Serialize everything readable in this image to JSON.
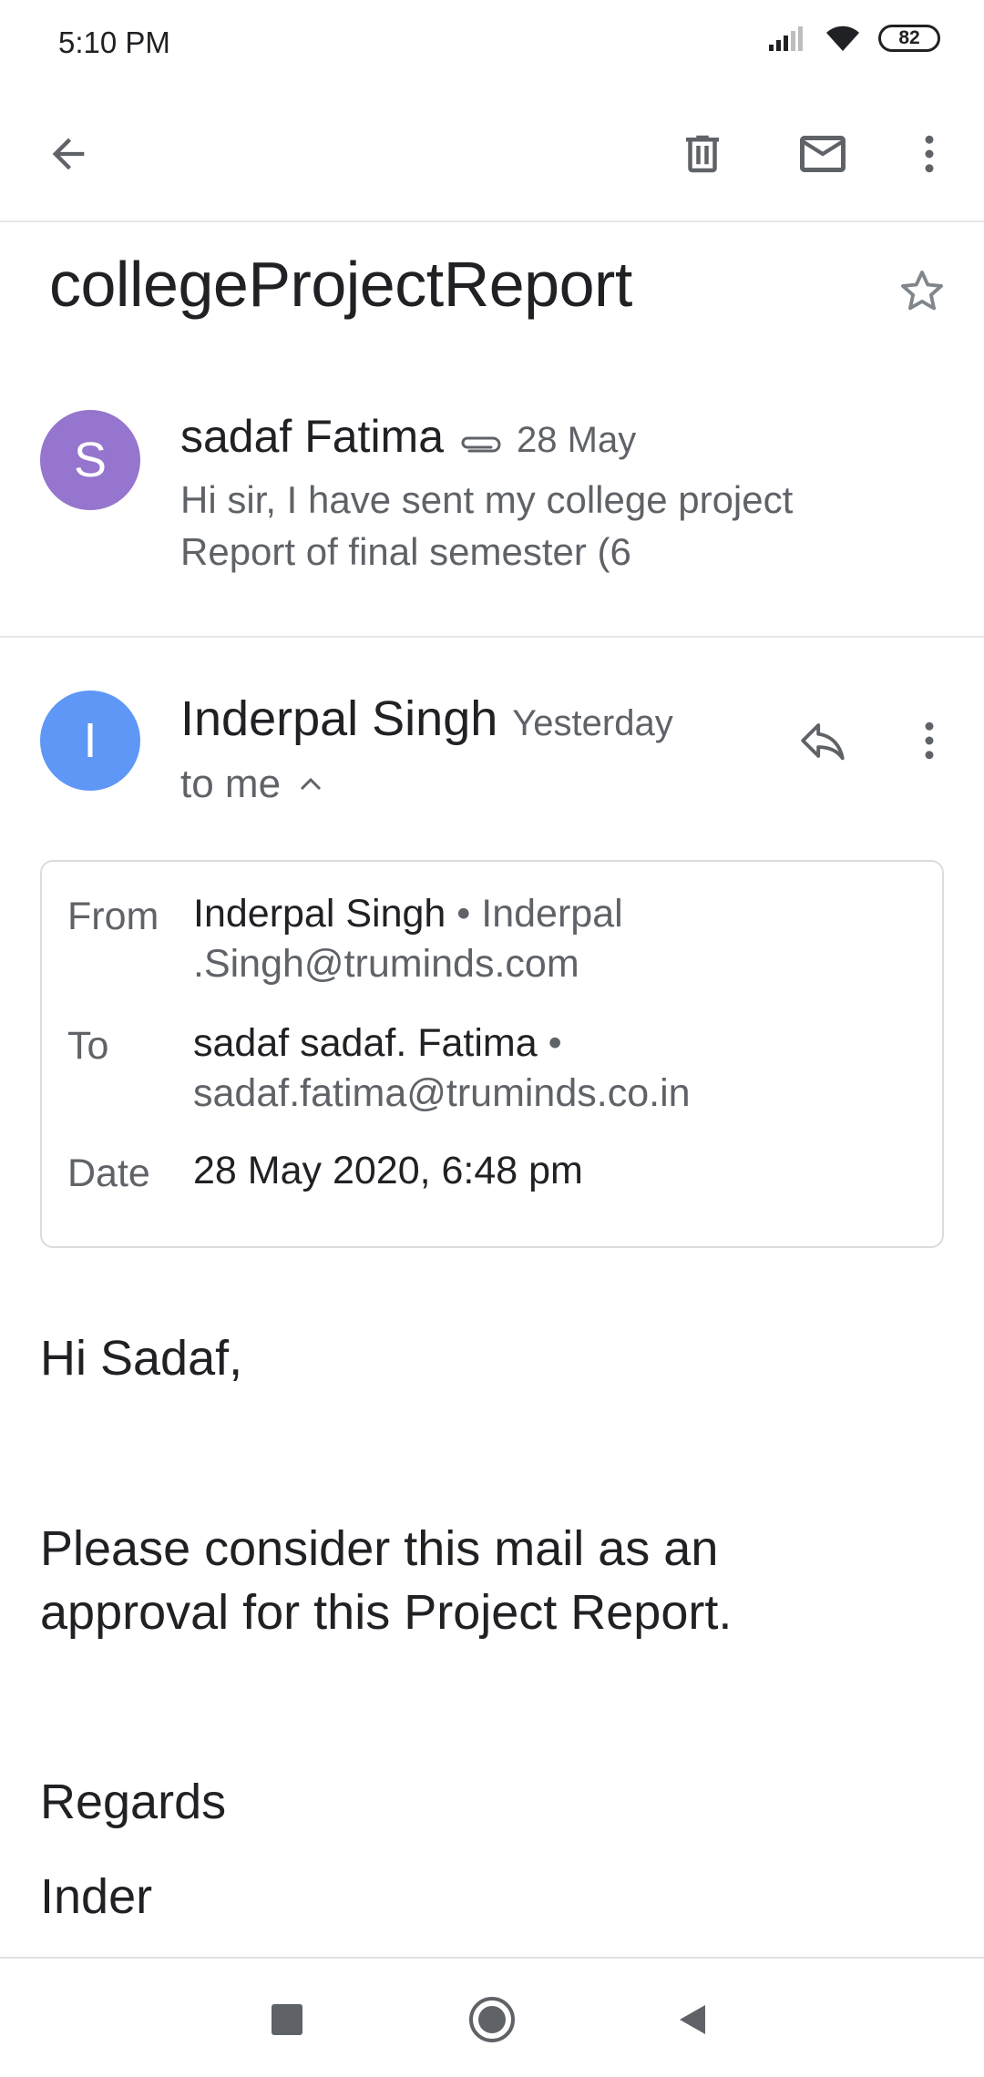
{
  "status_bar": {
    "time": "5:10 PM",
    "battery": "82",
    "icons": [
      "signal-icon",
      "wifi-icon",
      "battery-icon"
    ]
  },
  "app_bar": {
    "icons": [
      "back-arrow-icon",
      "delete-icon",
      "mark-unread-icon",
      "more-vert-icon"
    ]
  },
  "subject": "collegeProjectReport",
  "thread": [
    {
      "avatar_letter": "S",
      "avatar_color": "#9575cd",
      "sender": "sadaf Fatima",
      "date": "28 May",
      "has_attachment": true,
      "snippet": "Hi sir, I have sent my college project Report of final semester (6"
    }
  ],
  "message": {
    "avatar_letter": "I",
    "avatar_color": "#5e97f6",
    "sender": "Inderpal Singh",
    "date": "Yesterday",
    "to": "to me",
    "details": {
      "from_label": "From",
      "from_name": "Inderpal Singh",
      "from_email": "Inderpal .Singh@truminds.com",
      "to_label": "To",
      "to_name": "sadaf sadaf. Fatima",
      "to_email": "sadaf.fatima@truminds.co.in",
      "date_label": "Date",
      "date_value": "28 May 2020, 6:48 pm"
    },
    "body": {
      "greeting": "Hi Sadaf,",
      "paragraph_line1": "Please consider this mail as an",
      "paragraph_line2": "approval for this Project Report.",
      "closing": "Regards",
      "signature": "Inder"
    }
  },
  "nav_bar": {
    "icons": [
      "recents-square-icon",
      "home-circle-icon",
      "back-triangle-icon"
    ]
  }
}
